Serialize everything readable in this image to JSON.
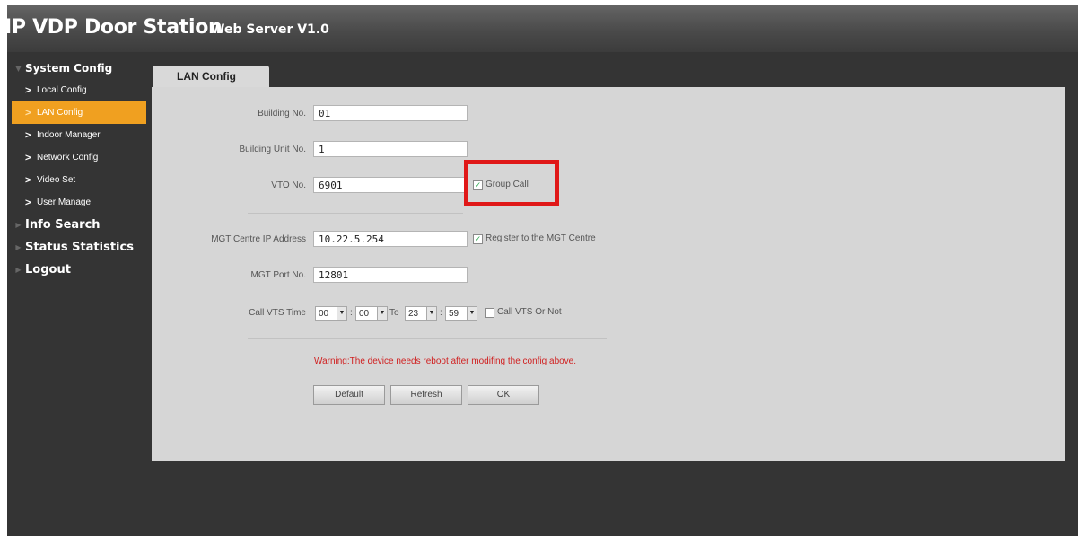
{
  "header": {
    "title": "IP VDP Door Station",
    "subtitle": "Web Server V1.0"
  },
  "sidebar": {
    "system_config": "System Config",
    "items": [
      {
        "label": "Local Config"
      },
      {
        "label": "LAN Config"
      },
      {
        "label": "Indoor Manager"
      },
      {
        "label": "Network Config"
      },
      {
        "label": "Video Set"
      },
      {
        "label": "User Manage"
      }
    ],
    "info_search": "Info Search",
    "status_statistics": "Status Statistics",
    "logout": "Logout"
  },
  "tab": {
    "label": "LAN Config"
  },
  "form": {
    "building_no": {
      "label": "Building No.",
      "value": "01"
    },
    "building_unit_no": {
      "label": "Building Unit No.",
      "value": "1"
    },
    "vto_no": {
      "label": "VTO No.",
      "value": "6901"
    },
    "group_call": {
      "label": "Group Call",
      "checked": true
    },
    "mgt_ip": {
      "label": "MGT Centre IP Address",
      "value": "10.22.5.254"
    },
    "register_mgt": {
      "label": "Register to the MGT Centre",
      "checked": true
    },
    "mgt_port": {
      "label": "MGT Port No.",
      "value": "12801"
    },
    "call_vts_time": {
      "label": "Call VTS Time",
      "start_hour": "00",
      "start_min": "00",
      "to": "To",
      "end_hour": "23",
      "end_min": "59",
      "colon": ":"
    },
    "call_vts_or_not": {
      "label": "Call VTS Or Not",
      "checked": false
    }
  },
  "warning": "Warning:The device needs reboot after modifing the config above.",
  "buttons": {
    "default": "Default",
    "refresh": "Refresh",
    "ok": "OK"
  },
  "colors": {
    "active_nav": "#f0a020",
    "highlight": "#e01818",
    "warning": "#d02020"
  }
}
